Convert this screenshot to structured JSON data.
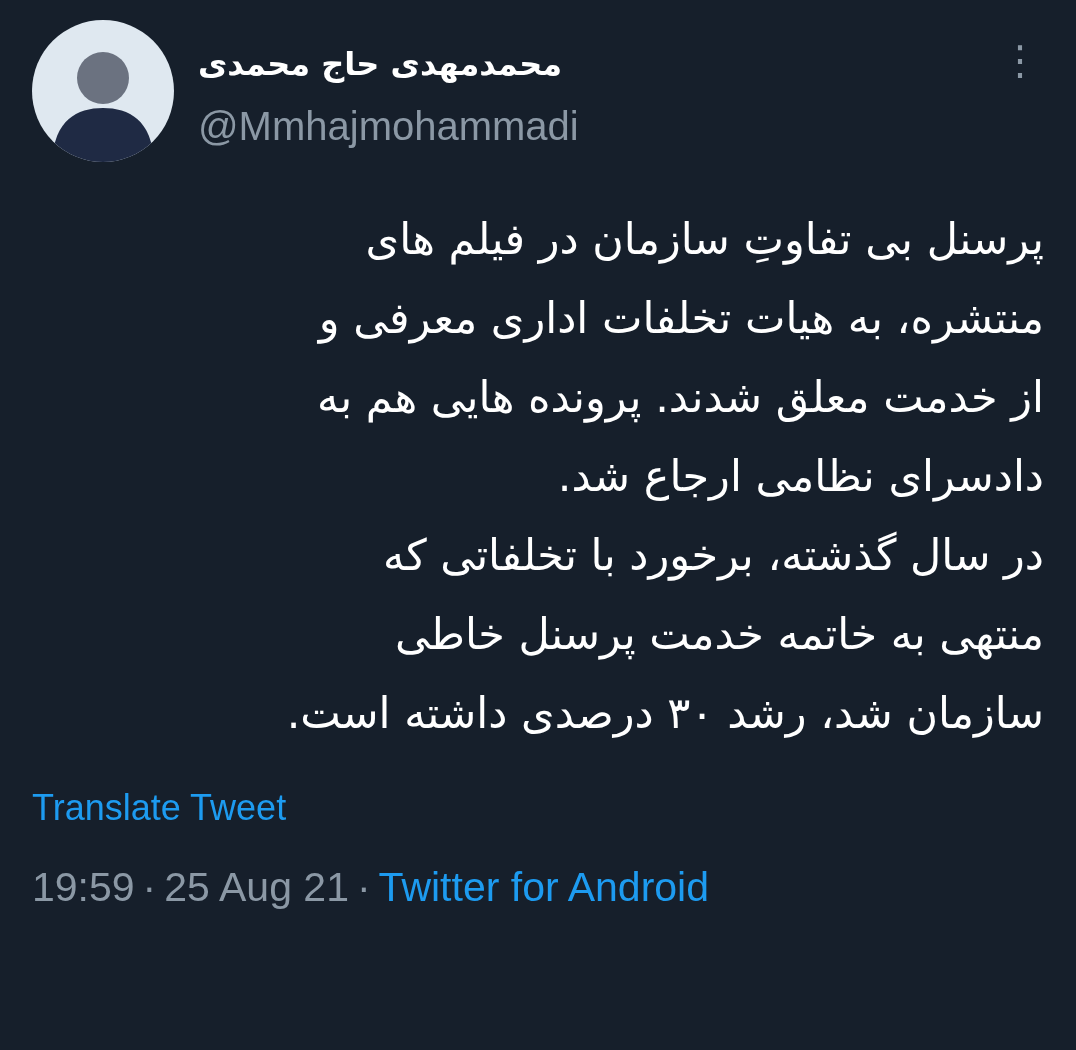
{
  "author": {
    "name": "محمدمهدی حاج محمدی",
    "handle": "@Mmhajmohammadi"
  },
  "menu": {
    "label": "⋮"
  },
  "tweet": {
    "text": "پرسنل بی تفاوتِ سازمان در فیلم های\nمنتشره، به هیات تخلفات اداری معرفی و\nاز خدمت معلق شدند. پرونده هایی هم به\nدادسرای نظامی ارجاع شد.\nدر سال گذشته، برخورد با تخلفاتی که\nمنتهی به خاتمه خدمت پرسنل خاطی\nسازمان شد، رشد ۳۰ درصدی داشته است."
  },
  "translate_link": "Translate Tweet",
  "meta": {
    "time": "19:59",
    "separator_1": "·",
    "date": "25 Aug 21",
    "separator_2": "·",
    "source": "Twitter for Android"
  }
}
